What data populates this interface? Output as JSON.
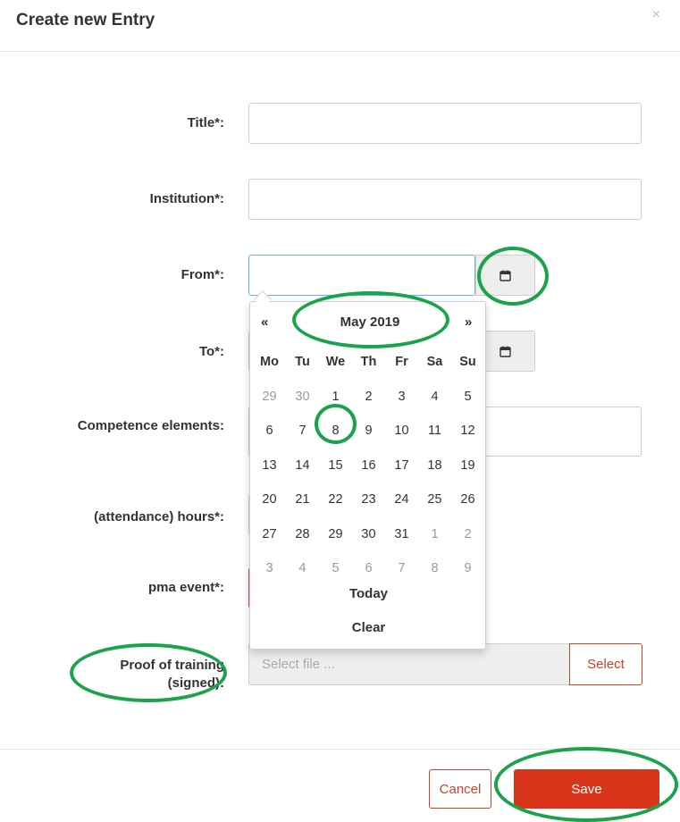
{
  "modal": {
    "title": "Create new Entry",
    "close_label": "×"
  },
  "fields": {
    "title_label": "Title*:",
    "institution_label": "Institution*:",
    "from_label": "From*:",
    "to_label": "To*:",
    "competence_label": "Competence elements:",
    "attendance_label": "(attendance) hours*:",
    "pma_label": "pma event*:",
    "proof_label_line1": "Proof of training",
    "proof_label_line2": "(signed):"
  },
  "file_input": {
    "placeholder": "Select file ...",
    "select_label": "Select"
  },
  "datepicker": {
    "prev": "«",
    "next": "»",
    "month_label": "May 2019",
    "weekdays": [
      "Mo",
      "Tu",
      "We",
      "Th",
      "Fr",
      "Sa",
      "Su"
    ],
    "weeks": [
      [
        "29",
        "30",
        "1",
        "2",
        "3",
        "4",
        "5"
      ],
      [
        "6",
        "7",
        "8",
        "9",
        "10",
        "11",
        "12"
      ],
      [
        "13",
        "14",
        "15",
        "16",
        "17",
        "18",
        "19"
      ],
      [
        "20",
        "21",
        "22",
        "23",
        "24",
        "25",
        "26"
      ],
      [
        "27",
        "28",
        "29",
        "30",
        "31",
        "1",
        "2"
      ],
      [
        "3",
        "4",
        "5",
        "6",
        "7",
        "8",
        "9"
      ]
    ],
    "today_label": "Today",
    "clear_label": "Clear"
  },
  "footer": {
    "cancel_label": "Cancel",
    "save_label": "Save"
  },
  "colors": {
    "accent": "#d9351a",
    "annotation": "#1aa34a"
  },
  "icons": {
    "calendar": "calendar-icon"
  }
}
